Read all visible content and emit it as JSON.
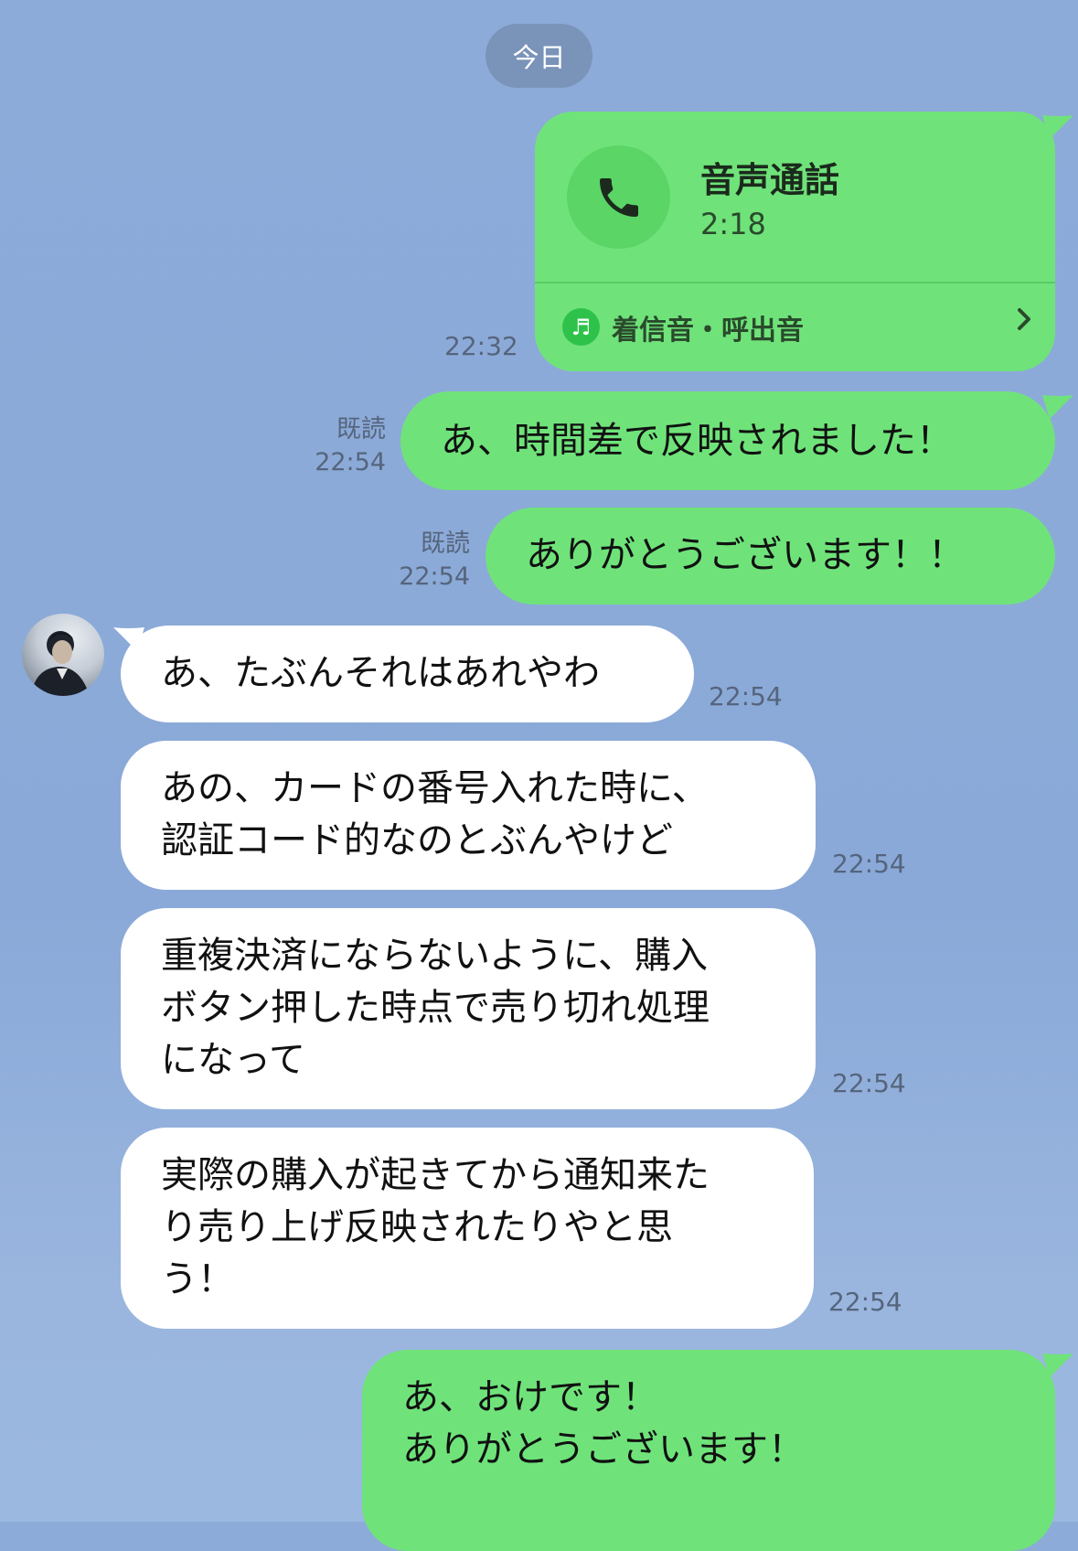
{
  "date_separator": "今日",
  "call": {
    "title": "音声通話",
    "duration": "2:18",
    "ringtone_label": "着信音・呼出音",
    "time": "22:32"
  },
  "messages": [
    {
      "side": "sent",
      "text": "あ、時間差で反映されました！",
      "read": "既読",
      "time": "22:54"
    },
    {
      "side": "sent",
      "text": "ありがとうございます！！",
      "read": "既読",
      "time": "22:54"
    },
    {
      "side": "received",
      "text": "あ、たぶんそれはあれやわ",
      "time": "22:54"
    },
    {
      "side": "received",
      "text": "あの、カードの番号入れた時に、\n認証コード的なのとぶんやけど",
      "time": "22:54"
    },
    {
      "side": "received",
      "text": "重複決済にならないように、購入\nボタン押した時点で売り切れ処理\nになって",
      "time": "22:54"
    },
    {
      "side": "received",
      "text": "実際の購入が起きてから通知来た\nり売り上げ反映されたりやと思\nう！",
      "time": "22:54"
    },
    {
      "side": "sent",
      "text": "あ、おけです！\nありがとうございます！"
    }
  ]
}
